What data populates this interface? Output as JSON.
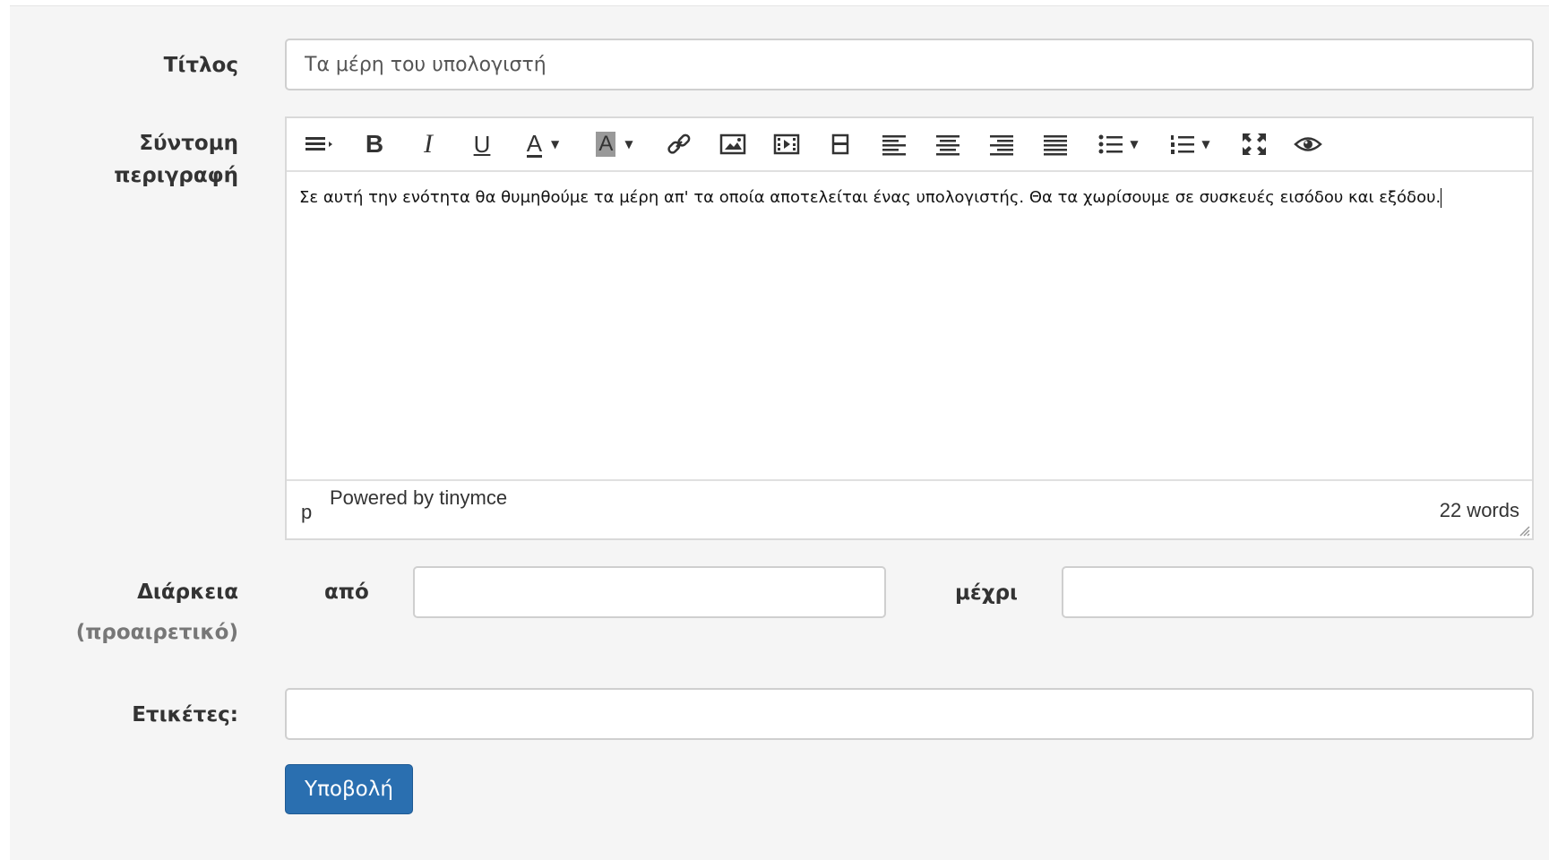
{
  "form": {
    "title": {
      "label": "Τίτλος",
      "value": "Τα μέρη του υπολογιστή"
    },
    "description": {
      "label_line1": "Σύντομη",
      "label_line2": "περιγραφή",
      "content": "Σε αυτή την ενότητα θα θυμηθούμε τα μέρη απ' τα οποία αποτελείται ένας υπολογιστής. Θα τα χωρίσουμε σε συσκευές εισόδου και εξόδου.",
      "toolbar": [
        {
          "icon": "format-block-icon"
        },
        {
          "icon": "bold-icon",
          "glyph": "B"
        },
        {
          "icon": "italic-icon",
          "glyph": "I"
        },
        {
          "icon": "underline-icon",
          "glyph": "U"
        },
        {
          "icon": "text-color-icon",
          "glyph": "A"
        },
        {
          "icon": "background-color-icon",
          "glyph": "A"
        },
        {
          "icon": "link-icon"
        },
        {
          "icon": "image-icon"
        },
        {
          "icon": "media-icon"
        },
        {
          "icon": "template-icon"
        },
        {
          "icon": "align-left-icon"
        },
        {
          "icon": "align-center-icon"
        },
        {
          "icon": "align-right-icon"
        },
        {
          "icon": "align-justify-icon"
        },
        {
          "icon": "bullet-list-icon"
        },
        {
          "icon": "numbered-list-icon"
        },
        {
          "icon": "fullscreen-icon"
        },
        {
          "icon": "preview-icon"
        }
      ],
      "status": {
        "path": "p",
        "powered_by": "Powered by tinymce",
        "word_count": "22 words"
      }
    },
    "duration": {
      "label": "Διάρκεια",
      "label_note": "(προαιρετικό)",
      "from_label": "από",
      "from_value": "",
      "to_label": "μέχρι",
      "to_value": ""
    },
    "tags": {
      "label": "Ετικέτες:",
      "value": ""
    },
    "submit_label": "Υποβολή"
  },
  "colors": {
    "panel_bg": "#f5f5f5",
    "submit_bg": "#2a6fb0",
    "border": "#cfcfcf"
  }
}
